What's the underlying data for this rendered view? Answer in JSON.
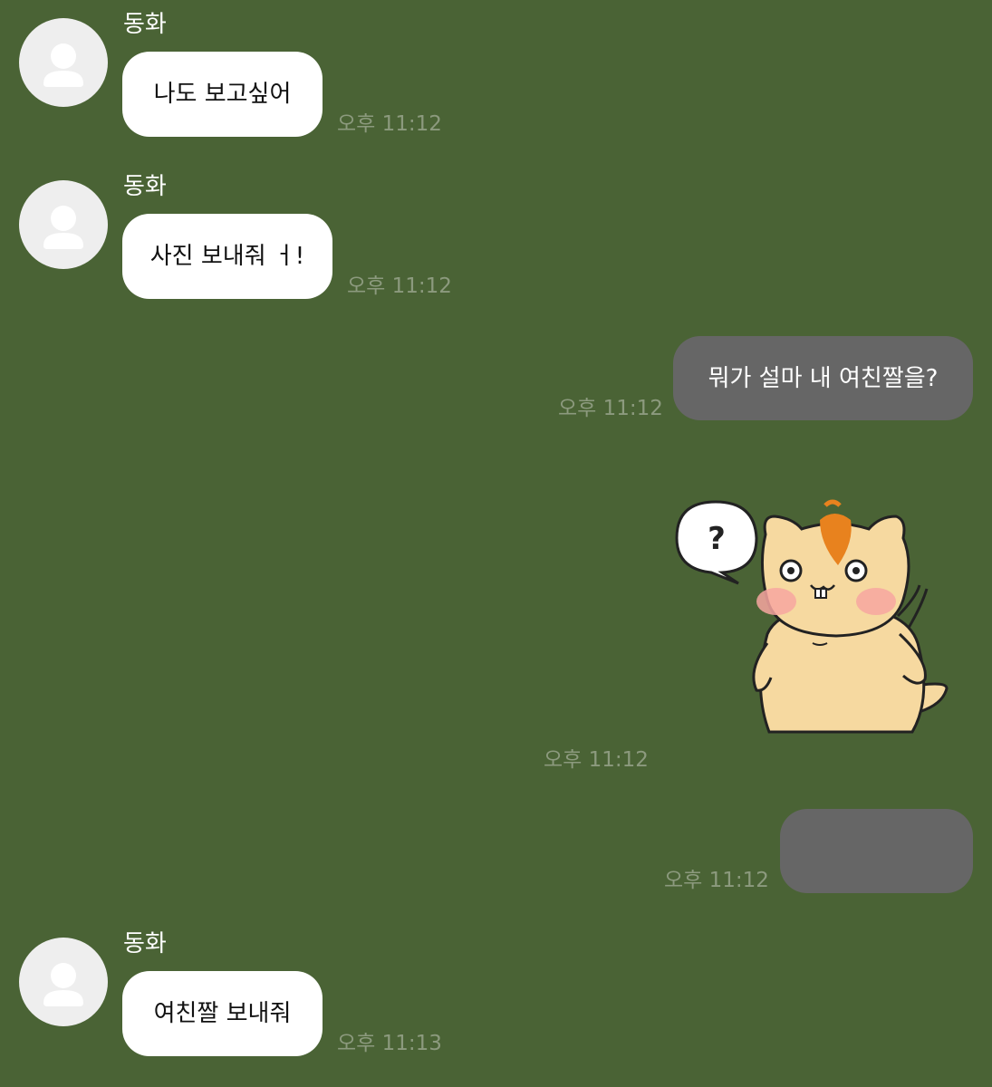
{
  "chat": {
    "messages": [
      {
        "sender": "동화",
        "text": "나도 보고싶어",
        "time": "오후 11:12"
      },
      {
        "sender": "동화",
        "text": "사진 보내줘 ㅓ!",
        "time": "오후 11:12"
      },
      {
        "text": "뭐가 설마 내 여친짤을?",
        "time": "오후 11:12"
      },
      {
        "sticker": "hamster-question-sticker",
        "time": "오후 11:12"
      },
      {
        "text": "",
        "time": "오후 11:12"
      },
      {
        "sender": "동화",
        "text": "여친짤 보내줘",
        "time": "오후 11:13"
      }
    ]
  },
  "colors": {
    "background": "#4a6335",
    "incoming_bubble": "#ffffff",
    "outgoing_bubble": "#666666",
    "timestamp": "#8c9a7e",
    "avatar": "#eeeeee"
  },
  "icons": {
    "avatar": "person-silhouette-icon",
    "sticker_bubble": "question-mark-speech-bubble"
  }
}
